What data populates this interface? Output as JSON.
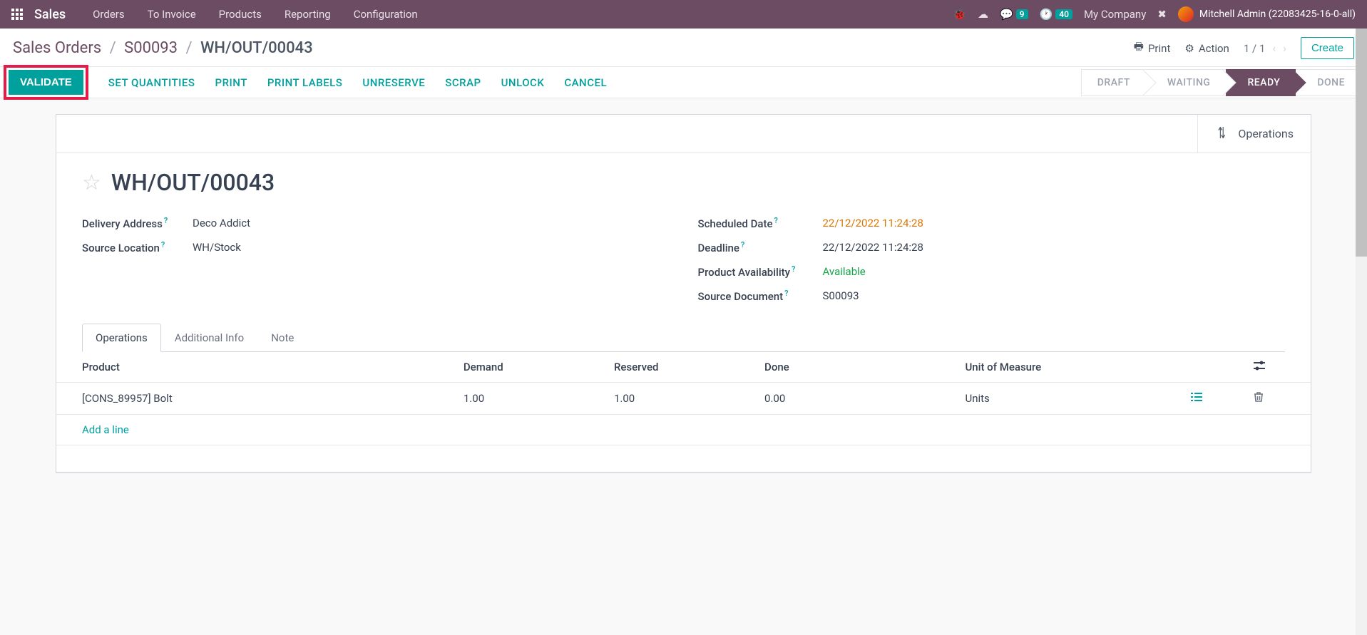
{
  "navbar": {
    "brand": "Sales",
    "items": [
      "Orders",
      "To Invoice",
      "Products",
      "Reporting",
      "Configuration"
    ],
    "chat_badge": "9",
    "activity_badge": "40",
    "company": "My Company",
    "user": "Mitchell Admin (22083425-16-0-all)"
  },
  "breadcrumb": {
    "root": "Sales Orders",
    "parent": "S00093",
    "current": "WH/OUT/00043",
    "print": "Print",
    "action": "Action",
    "pager": "1 / 1",
    "create": "Create"
  },
  "toolbar": {
    "validate": "VALIDATE",
    "set_quantities": "SET QUANTITIES",
    "print": "PRINT",
    "print_labels": "PRINT LABELS",
    "unreserve": "UNRESERVE",
    "scrap": "SCRAP",
    "unlock": "UNLOCK",
    "cancel": "CANCEL"
  },
  "status": {
    "draft": "DRAFT",
    "waiting": "WAITING",
    "ready": "READY",
    "done": "DONE"
  },
  "stat_button": {
    "label": "Operations"
  },
  "record": {
    "title": "WH/OUT/00043",
    "fields_left": {
      "delivery_address_label": "Delivery Address",
      "delivery_address_value": "Deco Addict",
      "source_location_label": "Source Location",
      "source_location_value": "WH/Stock"
    },
    "fields_right": {
      "scheduled_date_label": "Scheduled Date",
      "scheduled_date_value": "22/12/2022 11:24:28",
      "deadline_label": "Deadline",
      "deadline_value": "22/12/2022 11:24:28",
      "availability_label": "Product Availability",
      "availability_value": "Available",
      "source_doc_label": "Source Document",
      "source_doc_value": "S00093"
    }
  },
  "tabs": {
    "operations": "Operations",
    "additional": "Additional Info",
    "note": "Note"
  },
  "table": {
    "headers": {
      "product": "Product",
      "demand": "Demand",
      "reserved": "Reserved",
      "done": "Done",
      "uom": "Unit of Measure"
    },
    "row": {
      "product": "[CONS_89957] Bolt",
      "demand": "1.00",
      "reserved": "1.00",
      "done": "0.00",
      "uom": "Units"
    },
    "add_line": "Add a line"
  }
}
